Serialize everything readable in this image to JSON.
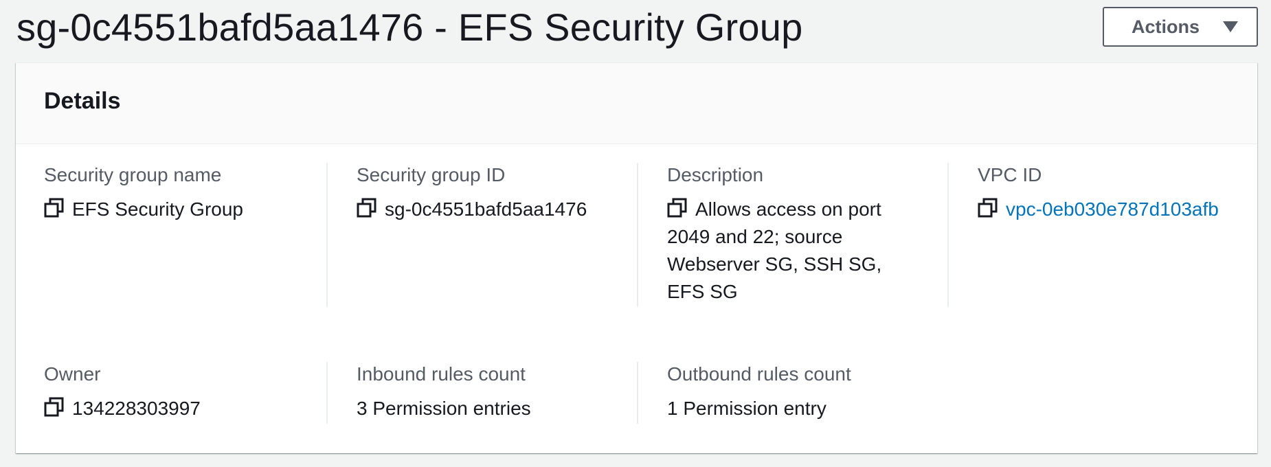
{
  "page": {
    "title": "sg-0c4551bafd5aa1476 - EFS Security Group",
    "actions_label": "Actions"
  },
  "panel": {
    "title": "Details"
  },
  "fields": {
    "sg_name": {
      "label": "Security group name",
      "value": "EFS Security Group"
    },
    "sg_id": {
      "label": "Security group ID",
      "value": "sg-0c4551bafd5aa1476"
    },
    "description": {
      "label": "Description",
      "value": "Allows access on port 2049 and 22; source Webserver SG, SSH SG, EFS SG"
    },
    "vpc_id": {
      "label": "VPC ID",
      "value": "vpc-0eb030e787d103afb"
    },
    "owner": {
      "label": "Owner",
      "value": "134228303997"
    },
    "inbound": {
      "label": "Inbound rules count",
      "value": "3 Permission entries"
    },
    "outbound": {
      "label": "Outbound rules count",
      "value": "1 Permission entry"
    }
  },
  "colors": {
    "background": "#f2f3f3",
    "link": "#0073bb",
    "label": "#545b64",
    "text": "#16191f"
  },
  "icons": {
    "copy": "copy-icon",
    "actions_caret": "caret-down-icon"
  }
}
